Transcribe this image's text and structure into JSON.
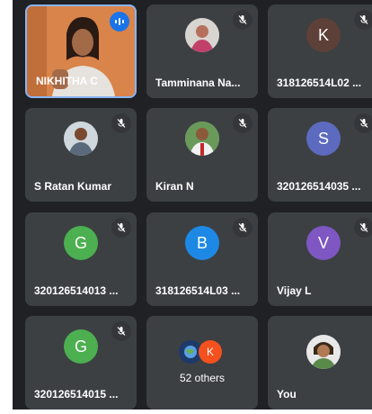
{
  "participants": [
    {
      "name": "NIKHITHA C",
      "kind": "video",
      "speaking": true
    },
    {
      "name": "Tamminana Na...",
      "kind": "photo",
      "muted": true
    },
    {
      "name": "318126514L02 ...",
      "kind": "letter",
      "letter": "K",
      "color": "#5d4037",
      "muted": true
    },
    {
      "name": "S Ratan Kumar",
      "kind": "photo",
      "muted": true
    },
    {
      "name": "Kiran N",
      "kind": "photo",
      "muted": true
    },
    {
      "name": "320126514035 ...",
      "kind": "letter",
      "letter": "S",
      "color": "#5c6bc0",
      "muted": true
    },
    {
      "name": "320126514013 ...",
      "kind": "letter",
      "letter": "G",
      "color": "#4caf50",
      "muted": true
    },
    {
      "name": "318126514L03 ...",
      "kind": "letter",
      "letter": "B",
      "color": "#1e88e5",
      "muted": true
    },
    {
      "name": "Vijay L",
      "kind": "letter",
      "letter": "V",
      "color": "#7e57c2",
      "muted": true
    },
    {
      "name": "320126514015 ...",
      "kind": "letter",
      "letter": "G",
      "color": "#4caf50",
      "muted": true
    },
    {
      "name": "You",
      "kind": "photo",
      "muted": false
    }
  ],
  "others": {
    "label": "52 others",
    "letter": "K",
    "letter_color": "#f4511e"
  },
  "colors": {
    "background": "#202124",
    "tile": "#3c4043",
    "speaking_border": "#8ab4f8",
    "audio_indicator": "#1a73e8"
  },
  "icons": {
    "muted": "mic-off-icon",
    "speaking": "audio-level-icon"
  }
}
